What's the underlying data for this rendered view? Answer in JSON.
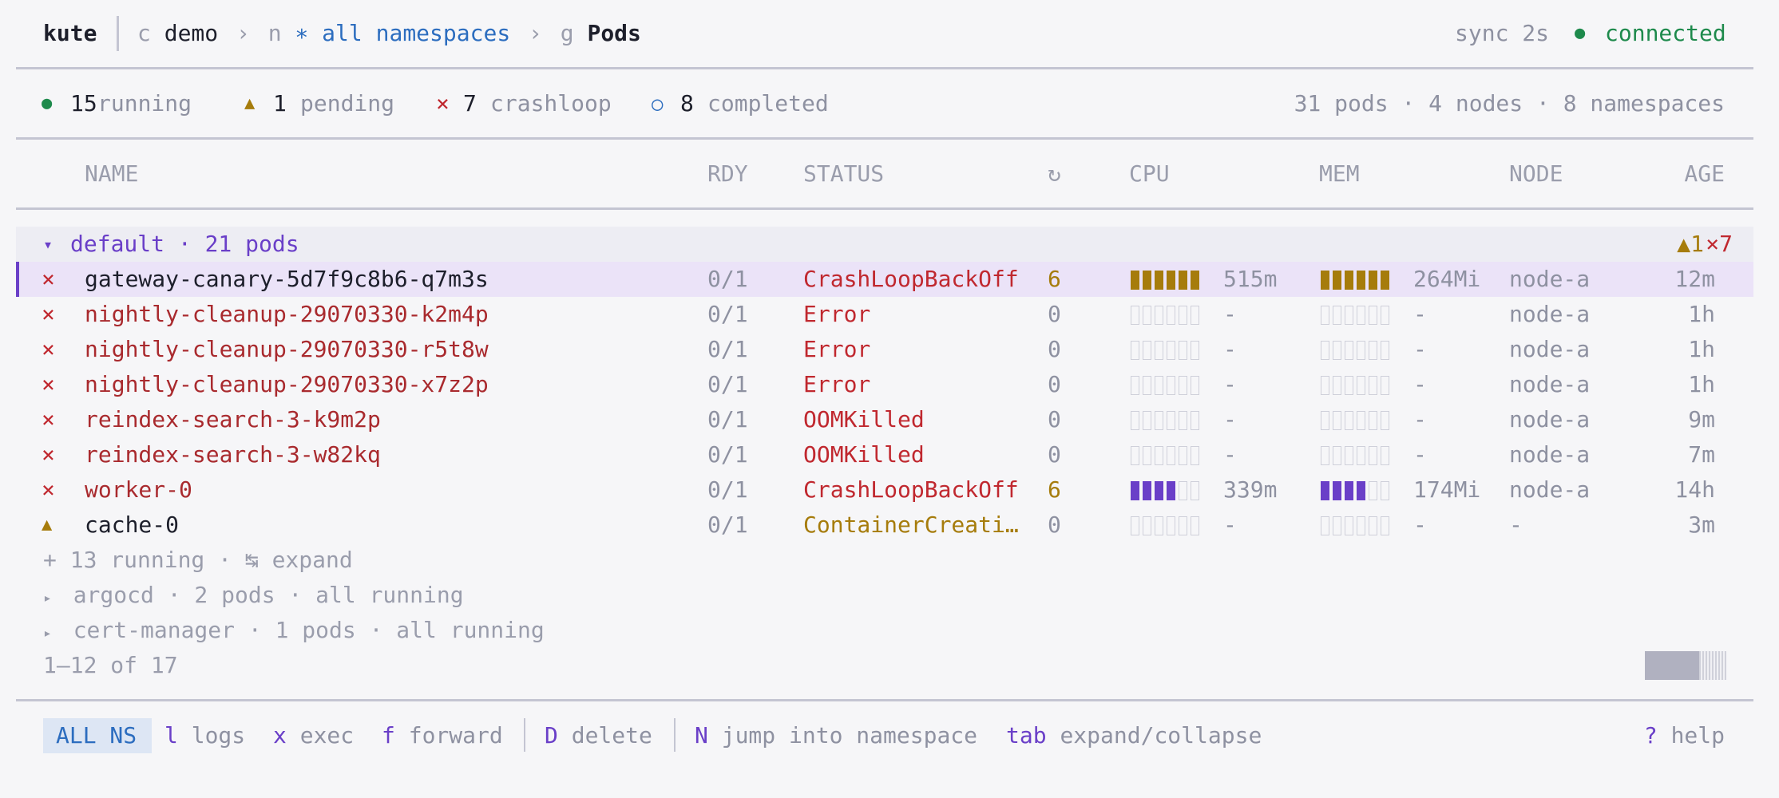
{
  "header": {
    "app": "kute",
    "crumbs": [
      {
        "prefix": "c",
        "label": "demo"
      },
      {
        "prefix": "n",
        "label": "∗ all namespaces"
      },
      {
        "prefix": "g",
        "label": "Pods"
      }
    ],
    "sep": "›",
    "sync": "sync 2s",
    "status_dot": "●",
    "status": "connected"
  },
  "summary": {
    "running": {
      "icon": "●",
      "count": "15",
      "label": "running"
    },
    "pending": {
      "icon": "▲",
      "count": "1",
      "label": "pending"
    },
    "crashloop": {
      "icon": "×",
      "count": "7",
      "label": "crashloop"
    },
    "completed": {
      "icon": "○",
      "count": "8",
      "label": "completed"
    },
    "totals": "31 pods · 4 nodes · 8 namespaces"
  },
  "columns": {
    "name": "NAME",
    "ready": "RDY",
    "status": "STATUS",
    "restarts_icon": "↻",
    "cpu": "CPU",
    "mem": "MEM",
    "node": "NODE",
    "age": "AGE"
  },
  "group": {
    "caret": "▾",
    "label": "default · 21 pods",
    "badge_pending": "▲1",
    "badge_crash": "×7"
  },
  "pods": [
    {
      "icon": "×",
      "name": "gateway-canary-5d7f9c8b6-q7m3s",
      "ready": "0/1",
      "status": "CrashLoopBackOff",
      "restarts": "6",
      "cpu_level": 6,
      "cpu": "515m",
      "mem_level": 6,
      "mem": "264Mi",
      "node": "node-a",
      "age": "12m"
    },
    {
      "icon": "×",
      "name": "nightly-cleanup-29070330-k2m4p",
      "ready": "0/1",
      "status": "Error",
      "restarts": "0",
      "cpu_level": 0,
      "cpu": "-",
      "mem_level": 0,
      "mem": "-",
      "node": "node-a",
      "age": "1h"
    },
    {
      "icon": "×",
      "name": "nightly-cleanup-29070330-r5t8w",
      "ready": "0/1",
      "status": "Error",
      "restarts": "0",
      "cpu_level": 0,
      "cpu": "-",
      "mem_level": 0,
      "mem": "-",
      "node": "node-a",
      "age": "1h"
    },
    {
      "icon": "×",
      "name": "nightly-cleanup-29070330-x7z2p",
      "ready": "0/1",
      "status": "Error",
      "restarts": "0",
      "cpu_level": 0,
      "cpu": "-",
      "mem_level": 0,
      "mem": "-",
      "node": "node-a",
      "age": "1h"
    },
    {
      "icon": "×",
      "name": "reindex-search-3-k9m2p",
      "ready": "0/1",
      "status": "OOMKilled",
      "restarts": "0",
      "cpu_level": 0,
      "cpu": "-",
      "mem_level": 0,
      "mem": "-",
      "node": "node-a",
      "age": "9m"
    },
    {
      "icon": "×",
      "name": "reindex-search-3-w82kq",
      "ready": "0/1",
      "status": "OOMKilled",
      "restarts": "0",
      "cpu_level": 0,
      "cpu": "-",
      "mem_level": 0,
      "mem": "-",
      "node": "node-a",
      "age": "7m"
    },
    {
      "icon": "×",
      "name": "worker-0",
      "ready": "0/1",
      "status": "CrashLoopBackOff",
      "restarts": "6",
      "cpu_level": 4,
      "cpu": "339m",
      "mem_level": 4,
      "mem": "174Mi",
      "node": "node-a",
      "age": "14h"
    },
    {
      "icon": "▲",
      "name": "cache-0",
      "ready": "0/1",
      "status": "ContainerCreati…",
      "restarts": "0",
      "cpu_level": 0,
      "cpu": "-",
      "mem_level": 0,
      "mem": "-",
      "node": "-",
      "age": "3m"
    }
  ],
  "more": {
    "text": "+ 13 running · ↹ expand"
  },
  "collapsed_groups": [
    {
      "caret": "▸",
      "label": "argocd · 2 pods · all running"
    },
    {
      "caret": "▸",
      "label": "cert-manager · 1 pods · all running"
    }
  ],
  "pagination": "1–12 of 17",
  "scroll_fraction": 0.67,
  "footer": {
    "mode": "ALL NS",
    "keys": [
      {
        "key": "l",
        "label": "logs"
      },
      {
        "key": "x",
        "label": "exec"
      },
      {
        "key": "f",
        "label": "forward"
      },
      {
        "key": "D",
        "label": "delete"
      },
      {
        "key": "N",
        "label": "jump into namespace"
      },
      {
        "key": "tab",
        "label": "expand/collapse"
      }
    ],
    "help_key": "?",
    "help_label": "help"
  },
  "colors": {
    "accent": "#6a3fc8",
    "selected_row": "#ebe3f8",
    "error": "#c0282f",
    "warning": "#a67c0c",
    "ok": "#1e8a4c",
    "link": "#2c6dbf"
  }
}
